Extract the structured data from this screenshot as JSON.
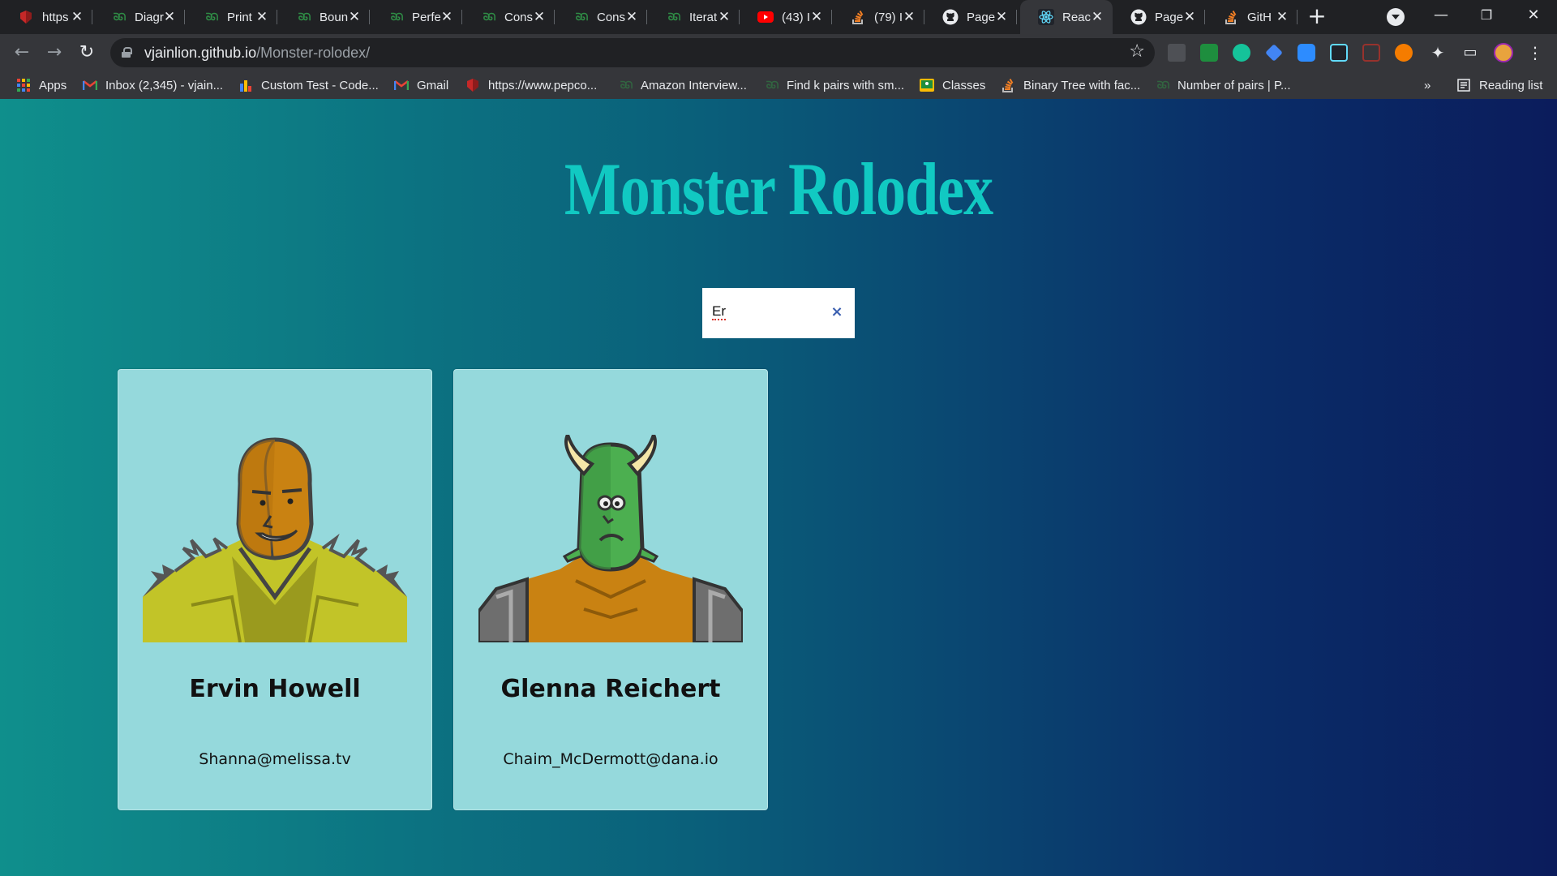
{
  "browser": {
    "tabs": [
      {
        "label": "https",
        "icon": "red-shield-icon"
      },
      {
        "label": "Diagr",
        "icon": "gfg-icon"
      },
      {
        "label": "Print",
        "icon": "gfg-icon"
      },
      {
        "label": "Boun",
        "icon": "gfg-icon"
      },
      {
        "label": "Perfe",
        "icon": "gfg-icon"
      },
      {
        "label": "Cons",
        "icon": "gfg-icon"
      },
      {
        "label": "Cons",
        "icon": "gfg-icon"
      },
      {
        "label": "Iterat",
        "icon": "gfg-icon"
      },
      {
        "label": "(43) I",
        "icon": "youtube-icon"
      },
      {
        "label": "(79) I",
        "icon": "stackoverflow-icon"
      },
      {
        "label": "Page",
        "icon": "github-icon"
      },
      {
        "label": "Reac",
        "icon": "react-icon",
        "active": true
      },
      {
        "label": "Page",
        "icon": "github-icon"
      },
      {
        "label": "GitH",
        "icon": "stackoverflow-icon"
      }
    ],
    "url_host": "vjainlion.github.io",
    "url_path": "/Monster-rolodex/",
    "bookmarks": [
      {
        "label": "Apps",
        "icon": "apps-grid-icon"
      },
      {
        "label": "Inbox (2,345) - vjain...",
        "icon": "gmail-icon"
      },
      {
        "label": "Custom Test - Code...",
        "icon": "bar-chart-icon"
      },
      {
        "label": "Gmail",
        "icon": "gmail-icon"
      },
      {
        "label": "https://www.pepco...",
        "icon": "red-shield-icon"
      },
      {
        "label": "Amazon Interview...",
        "icon": "gfg-icon"
      },
      {
        "label": "Find k pairs with sm...",
        "icon": "gfg-icon"
      },
      {
        "label": "Classes",
        "icon": "classroom-icon"
      },
      {
        "label": "Binary Tree with fac...",
        "icon": "stackoverflow-icon"
      },
      {
        "label": "Number of pairs | P...",
        "icon": "gfg-icon"
      }
    ],
    "reading_list": "Reading list",
    "more_bookmarks": "»"
  },
  "app": {
    "title": "Monster Rolodex",
    "search_value": "Er",
    "clear_symbol": "×",
    "monsters": [
      {
        "name": "Ervin Howell",
        "email": "Shanna@melissa.tv"
      },
      {
        "name": "Glenna Reichert",
        "email": "Chaim_McDermott@dana.io"
      }
    ]
  },
  "colors": {
    "title": "#11c9c2",
    "card_bg": "#95d9dc",
    "gradient_start": "#0f8f8c",
    "gradient_end": "#0b1c5c"
  }
}
